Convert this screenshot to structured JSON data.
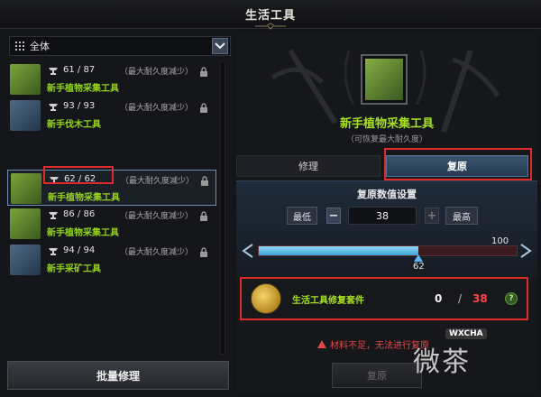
{
  "window": {
    "title": "生活工具"
  },
  "left": {
    "filter": {
      "selected": "全体"
    },
    "tools": [
      {
        "durability": "61 / 87",
        "note": "（最大耐久度减少）",
        "name": "新手植物采集工具",
        "thumb": "gloves-sack-icon",
        "selected": false
      },
      {
        "durability": "93 / 93",
        "note": "（最大耐久度减少）",
        "name": "新手伐木工具",
        "thumb": "axe-icon",
        "selected": false
      },
      {
        "durability": "62 / 62",
        "note": "（最大耐久度减少）",
        "name": "新手植物采集工具",
        "thumb": "gloves-sack-icon",
        "selected": true
      },
      {
        "durability": "86 / 86",
        "note": "（最大耐久度减少）",
        "name": "新手植物采集工具",
        "thumb": "gloves-sack-icon",
        "selected": false
      },
      {
        "durability": "94 / 94",
        "note": "（最大耐久度减少）",
        "name": "新手采矿工具",
        "thumb": "pickaxe-icon",
        "selected": false
      }
    ],
    "batch_repair_label": "批量修理"
  },
  "right": {
    "item": {
      "name": "新手植物采集工具",
      "subtitle": "（可恢复最大耐久度）"
    },
    "tabs": {
      "repair": "修理",
      "restore": "复原"
    },
    "settings": {
      "label": "复原数值设置",
      "min_label": "最低",
      "max_label": "最高",
      "value": "38",
      "slider_current": 62,
      "slider_max": 100,
      "slider_current_label": "62",
      "slider_max_label": "100"
    },
    "requirement": {
      "name": "生活工具修复套件",
      "have": "0",
      "slash": "/",
      "need": "38",
      "help": "?"
    },
    "warning": "材料不足，无法进行复原",
    "restore_button": "复原"
  },
  "watermark": {
    "text": "微茶",
    "badge": "WXCHA"
  },
  "colors": {
    "accent_green": "#a6e020",
    "warning_red": "#e04848",
    "tab_active": "#3b556f",
    "highlight_box": "#e02a2a"
  }
}
